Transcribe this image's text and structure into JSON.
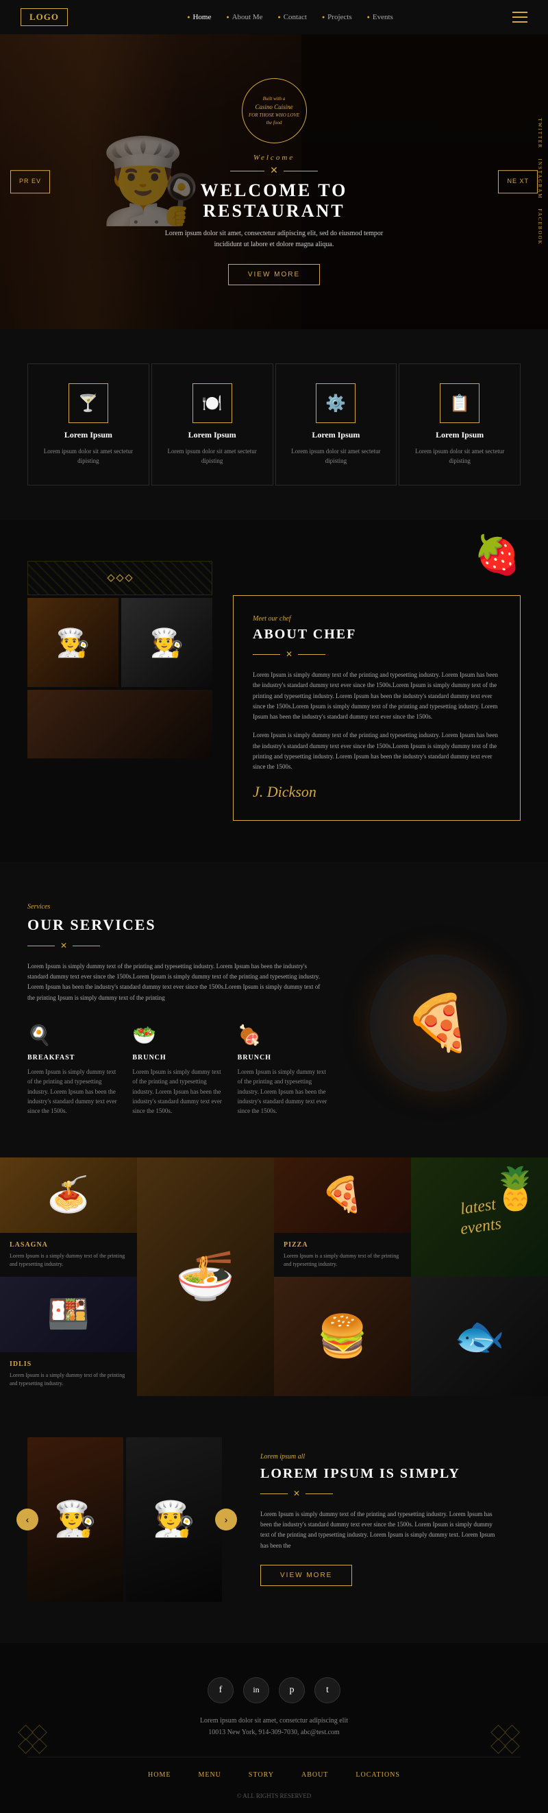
{
  "nav": {
    "logo": "LOGO",
    "links": [
      {
        "label": "Home",
        "active": true
      },
      {
        "label": "About Me"
      },
      {
        "label": "Contact"
      },
      {
        "label": "Projects"
      },
      {
        "label": "Events"
      }
    ]
  },
  "hero": {
    "badge_line1": "Built with a",
    "badge_line2": "Casino Cuisine",
    "badge_line3": "FOR THOSE WHO LOVE",
    "badge_line4": "the food",
    "welcome": "Welcome",
    "title": "WELCOME TO RESTAURANT",
    "subtitle": "Lorem ipsum dolor sit amet, consectetur adipiscing elit, sed do eiusmod tempor incididunt ut labore et dolore magna aliqua.",
    "btn": "VIEW MORE",
    "prev": "PR EV",
    "next": "NE XT",
    "socials": [
      "Twitter",
      "Instagram",
      "Facebook"
    ]
  },
  "features": [
    {
      "icon": "🍸",
      "title": "Lorem Ipsum",
      "text": "Lorem ipsum dolor sit amet sectetur dipisting"
    },
    {
      "icon": "🍽️",
      "title": "Lorem Ipsum",
      "text": "Lorem ipsum dolor sit amet sectetur dipisting"
    },
    {
      "icon": "⚙️",
      "title": "Lorem Ipsum",
      "text": "Lorem ipsum dolor sit amet sectetur dipisting"
    },
    {
      "icon": "📋",
      "title": "Lorem Ipsum",
      "text": "Lorem ipsum dolor sit amet sectetur dipisting"
    }
  ],
  "about": {
    "label": "Meet our chef",
    "title": "ABOUT CHEF",
    "body1": "Lorem Ipsum is simply dummy text of the printing and typesetting industry. Lorem Ipsum has been the industry's standard dummy text ever since the 1500s.Lorem Ipsum is simply dummy text of the printing and typesetting industry. Lorem Ipsum has been the industry's standard dummy text ever since the 1500s.Lorem Ipsum is simply dummy text of the printing and typesetting industry. Lorem Ipsum has been the industry's standard dummy text ever since the 1500s.",
    "body2": "Lorem Ipsum is simply dummy text of the printing and typesetting industry. Lorem Ipsum has been the industry's standard dummy text ever since the 1500s.Lorem Ipsum is simply dummy text of the printing and typesetting industry. Lorem Ipsum has been the industry's standard dummy text ever since the 1500s.",
    "signature": "J. Dickson"
  },
  "services": {
    "label": "Services",
    "title": "OUR SERVICES",
    "intro": "Lorem Ipsum is simply dummy text of the printing and typesetting industry. Lorem Ipsum has been the industry's standard dummy text ever since the 1500s.Lorem Ipsum is simply dummy text of the printing and typesetting industry. Lorem Ipsum has been the industry's standard dummy text ever since the 1500s.Lorem Ipsum is simply dummy text of the printing Ipsum is simply dummy text of the printing",
    "cards": [
      {
        "icon": "🍳",
        "title": "BREAKFAST",
        "text": "Lorem Ipsum is simply dummy text of the printing and typesetting industry. Lorem Ipsum has been the industry's standard dummy text ever since the 1500s."
      },
      {
        "icon": "🥗",
        "title": "BRUNCH",
        "text": "Lorem Ipsum is simply dummy text of the printing and typesetting industry. Lorem Ipsum has been the industry's standard dummy text ever since the 1500s."
      },
      {
        "icon": "🍖",
        "title": "BRUNCH",
        "text": "Lorem Ipsum is simply dummy text of the printing and typesetting industry. Lorem Ipsum has been the industry's standard dummy text ever since the 1500s."
      }
    ]
  },
  "events_foods": [
    {
      "title": "LASAGNA",
      "text": "Lorem Ipsum is a simply dummy text of the printing and typesetting industry.",
      "emoji": "🍝"
    },
    {
      "title": "PIZZA",
      "text": "Lorem Ipsum is a simply dummy text of the printing and typesetting industry.",
      "emoji": "🍕"
    },
    {
      "title": "latest events",
      "emoji": "🍍"
    },
    {
      "title": "IDLIS",
      "text": "Lorem Ipsum is a simply dummy text of the printing and typesetting industry.",
      "emoji": "🍱"
    },
    {
      "title": "",
      "text": "",
      "emoji": "🍔"
    },
    {
      "title": "",
      "text": "",
      "emoji": "🐟"
    }
  ],
  "testimonial": {
    "label": "Lorem ipsum all",
    "title": "LOREM IPSUM IS SIMPLY",
    "text": "Lorem Ipsum is simply dummy text of the printing and typesetting industry. Lorem Ipsum has been the industry's standard dummy text ever since the 1500s. Lorem Ipsum is simply dummy text of the printing and typesetting industry. Lorem Ipsum is simply dummy text. Lorem Ipsum has been the",
    "btn": "VIEW MORE"
  },
  "footer": {
    "socials": [
      "f",
      "in",
      "p",
      "t"
    ],
    "address_text": "Lorem ipsum dolor sit amet, consetctur adipiscing elit",
    "address": "10013 New York, 914-309-7030, abc@test.com",
    "nav_links": [
      "HOME",
      "MENU",
      "STORY",
      "ABOUT",
      "LOCATIONS"
    ],
    "copyright": "© ALL RIGHTS RESERVED"
  }
}
